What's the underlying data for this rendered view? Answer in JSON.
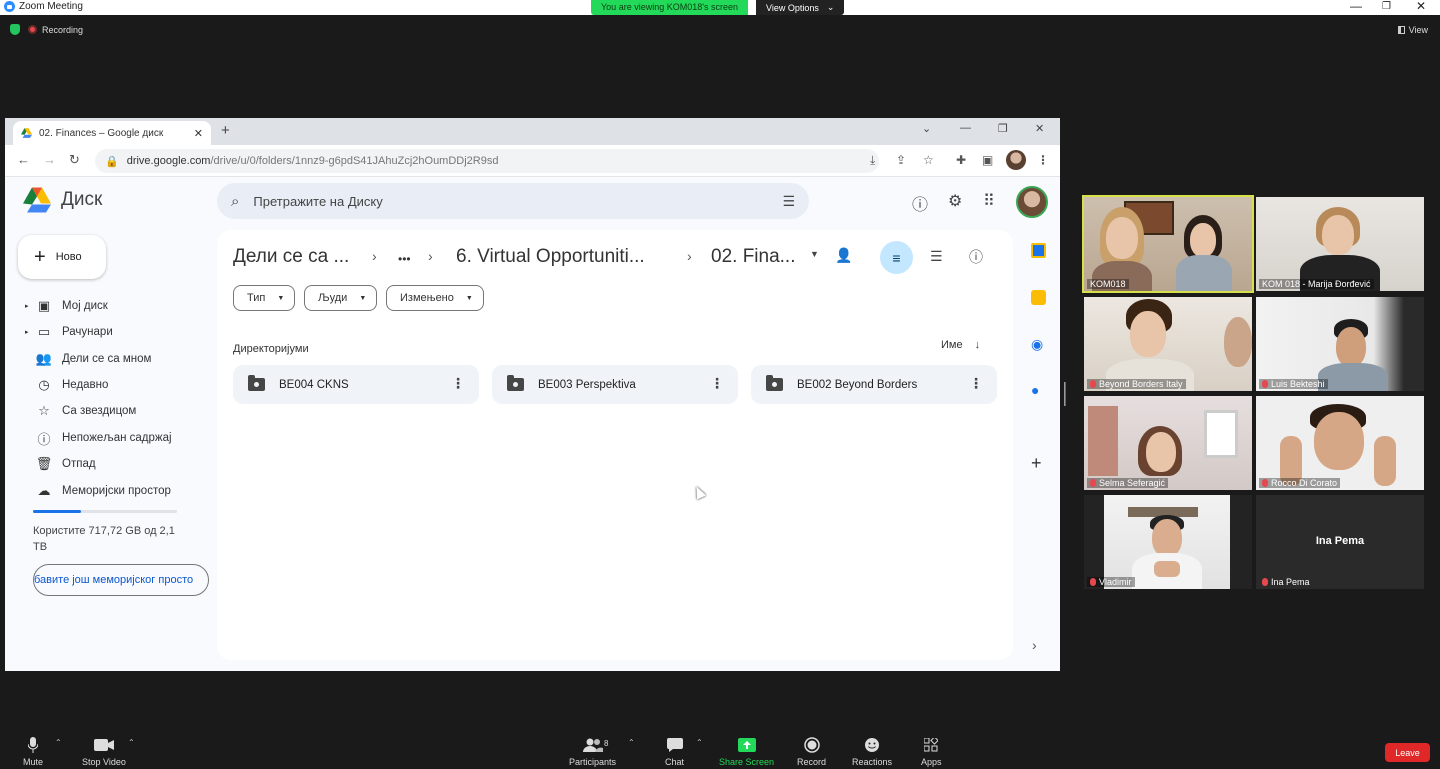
{
  "zoom": {
    "app_title": "Zoom Meeting",
    "share_banner": "You are viewing KOM018's screen",
    "view_options": "View Options",
    "recording": "Recording",
    "view_label": "View",
    "window_controls": [
      "—",
      "❐",
      "✕"
    ],
    "participants_count": "8",
    "toolbar": {
      "mute": "Mute",
      "stop_video": "Stop Video",
      "participants": "Participants",
      "chat": "Chat",
      "share_screen": "Share Screen",
      "record": "Record",
      "reactions": "Reactions",
      "apps": "Apps",
      "leave": "Leave"
    },
    "participants": [
      {
        "name": "KOM018",
        "active": true
      },
      {
        "name": "KOM 018 - Marija Đorđević"
      },
      {
        "name": "Beyond Borders Italy"
      },
      {
        "name": "Luis Bekteshi"
      },
      {
        "name": "Selma Seferagić"
      },
      {
        "name": "Rocco Di Corato"
      },
      {
        "name": "Vladimir"
      },
      {
        "name": "Ina Pema",
        "center_name": "Ina Pema"
      }
    ],
    "accent_share": "#23d959",
    "leave_color": "#e02828"
  },
  "browser": {
    "tab_title": "02. Finances – Google диск",
    "url_host": "drive.google.com",
    "url_path": "/drive/u/0/folders/1nnz9-g6pdS41JAhuZcj2hOumDDj2R9sd"
  },
  "drive": {
    "product_name": "Диск",
    "search_placeholder": "Претражите на Диску",
    "new_button": "Ново",
    "sidebar": [
      {
        "label": "Мој диск",
        "icon": "my-drive-icon",
        "caret": true
      },
      {
        "label": "Рачунари",
        "icon": "computers-icon",
        "caret": true
      },
      {
        "label": "Дели се са мном",
        "icon": "shared-icon"
      },
      {
        "label": "Недавно",
        "icon": "recent-icon"
      },
      {
        "label": "Са звездицом",
        "icon": "star-icon"
      },
      {
        "label": "Непожељан садржај",
        "icon": "spam-icon"
      },
      {
        "label": "Отпад",
        "icon": "trash-icon"
      },
      {
        "label": "Меморијски простор",
        "icon": "cloud-icon"
      }
    ],
    "storage_text": "Користите 717,72 GB од 2,1 ТВ",
    "storage_fraction": 0.33,
    "get_more_storage": "бавите још меморијског просто",
    "breadcrumb": [
      "Дели се са ...",
      "6. Virtual Opportuniti...",
      "02. Fina..."
    ],
    "breadcrumb_more": "•••",
    "filters": [
      "Тип",
      "Људи",
      "Измењено"
    ],
    "section_title": "Директоријуми",
    "sort_label": "Име",
    "folders": [
      "BE004 CKNS",
      "BE003 Perspektiva",
      "BE002 Beyond Borders"
    ]
  }
}
